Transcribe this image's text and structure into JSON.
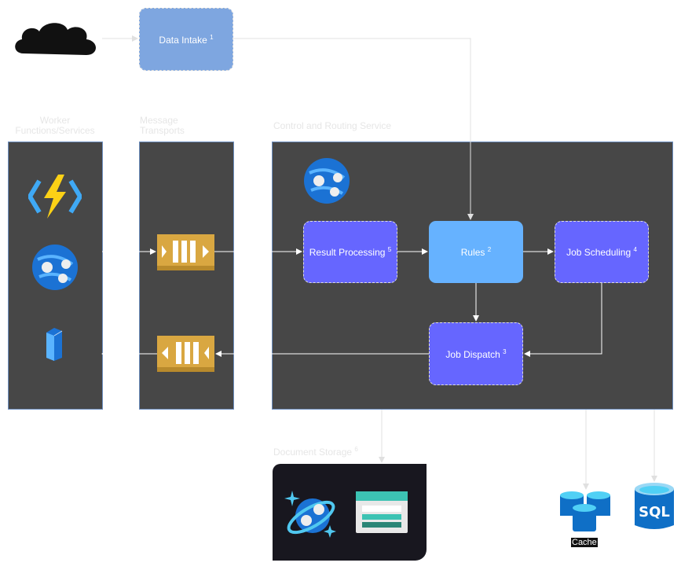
{
  "nodes": {
    "data_intake": {
      "label": "Data Intake",
      "ref": "1"
    },
    "result_processing": {
      "label": "Result Processing",
      "ref": "5"
    },
    "rules": {
      "label": "Rules",
      "ref": "2"
    },
    "job_scheduling": {
      "label": "Job Scheduling",
      "ref": "4"
    },
    "job_dispatch": {
      "label": "Job Dispatch",
      "ref": "3"
    }
  },
  "groups": {
    "workers": "Worker Functions/Services",
    "transports": "Message Transports",
    "control": "Control and Routing Service",
    "storage": {
      "label": "Document Storage",
      "ref": "6"
    }
  },
  "icons": {
    "cache_label": "Cache",
    "sql_label": "SQL"
  },
  "colors": {
    "intake": "#7ea6e0",
    "process": "#6666ff",
    "rules": "#66b2ff",
    "panel": "#474747",
    "queue": "#d9a741"
  }
}
